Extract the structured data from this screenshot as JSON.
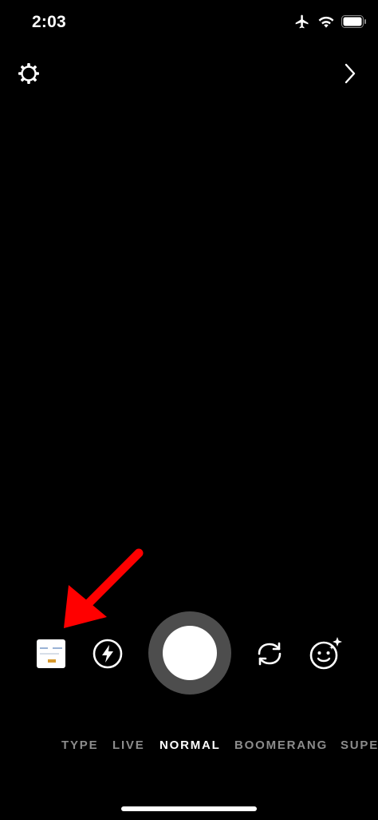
{
  "status_bar": {
    "time": "2:03",
    "icons": [
      "airplane-icon",
      "wifi-icon",
      "battery-icon"
    ]
  },
  "top_bar": {
    "left_icon": "gear-icon",
    "right_icon": "chevron-right-icon"
  },
  "controls": {
    "gallery_icon": "gallery-thumbnail",
    "flash_icon": "flash-icon",
    "shutter_icon": "shutter-button",
    "flip_icon": "flip-camera-icon",
    "face_icon": "face-filter-icon"
  },
  "modes": [
    {
      "label": "TYPE",
      "active": false
    },
    {
      "label": "LIVE",
      "active": false
    },
    {
      "label": "NORMAL",
      "active": true
    },
    {
      "label": "BOOMERANG",
      "active": false
    },
    {
      "label": "SUPE",
      "active": false
    }
  ],
  "colors": {
    "background": "#000000",
    "shutter_ring": "#4d4d4d",
    "annotation_arrow": "#ff0000",
    "mode_inactive": "#8c8c8c",
    "mode_active": "#ffffff"
  }
}
